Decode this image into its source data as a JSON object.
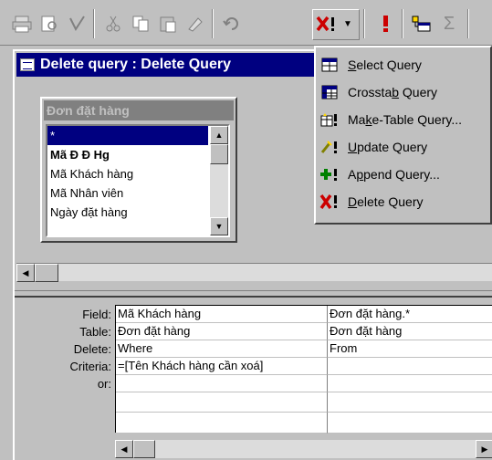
{
  "window": {
    "title": "Delete query : Delete Query"
  },
  "table_box": {
    "title": "Đơn đặt hàng",
    "fields": [
      "*",
      "Mã Đ Đ Hg",
      "Mã Khách hàng",
      "Mã Nhân viên",
      "Ngày đặt hàng"
    ]
  },
  "grid": {
    "row_labels": {
      "field": "Field:",
      "table": "Table:",
      "delete": "Delete:",
      "criteria": "Criteria:",
      "or": "or:"
    },
    "columns": [
      {
        "field": "Mã Khách hàng",
        "table": "Đơn đặt hàng",
        "delete": "Where",
        "criteria": "=[Tên Khách hàng cần xoá]",
        "or": ""
      },
      {
        "field": "Đơn đặt hàng.*",
        "table": "Đơn đặt hàng",
        "delete": "From",
        "criteria": "",
        "or": ""
      }
    ]
  },
  "query_type_menu": {
    "items": [
      {
        "pre": "",
        "key": "S",
        "post": "elect Query",
        "icon": "select-query-icon"
      },
      {
        "pre": "Crossta",
        "key": "b",
        "post": " Query",
        "icon": "crosstab-query-icon"
      },
      {
        "pre": "Ma",
        "key": "k",
        "post": "e-Table Query...",
        "icon": "make-table-query-icon"
      },
      {
        "pre": "",
        "key": "U",
        "post": "pdate Query",
        "icon": "update-query-icon"
      },
      {
        "pre": "A",
        "key": "p",
        "post": "pend Query...",
        "icon": "append-query-icon"
      },
      {
        "pre": "",
        "key": "D",
        "post": "elete Query",
        "icon": "delete-query-icon"
      }
    ]
  },
  "toolbar": {
    "buttons": [
      "print-icon",
      "print-preview-icon",
      "spelling-icon",
      "cut-icon",
      "copy-icon",
      "paste-icon",
      "format-painter-icon",
      "undo-icon",
      "query-type-icon",
      "run-icon",
      "show-table-icon",
      "totals-icon"
    ],
    "totals_glyph": "Σ"
  },
  "colors": {
    "title_bar": "#000080",
    "face": "#c0c0c0",
    "selection": "#000080",
    "delete_red": "#cc0000"
  }
}
